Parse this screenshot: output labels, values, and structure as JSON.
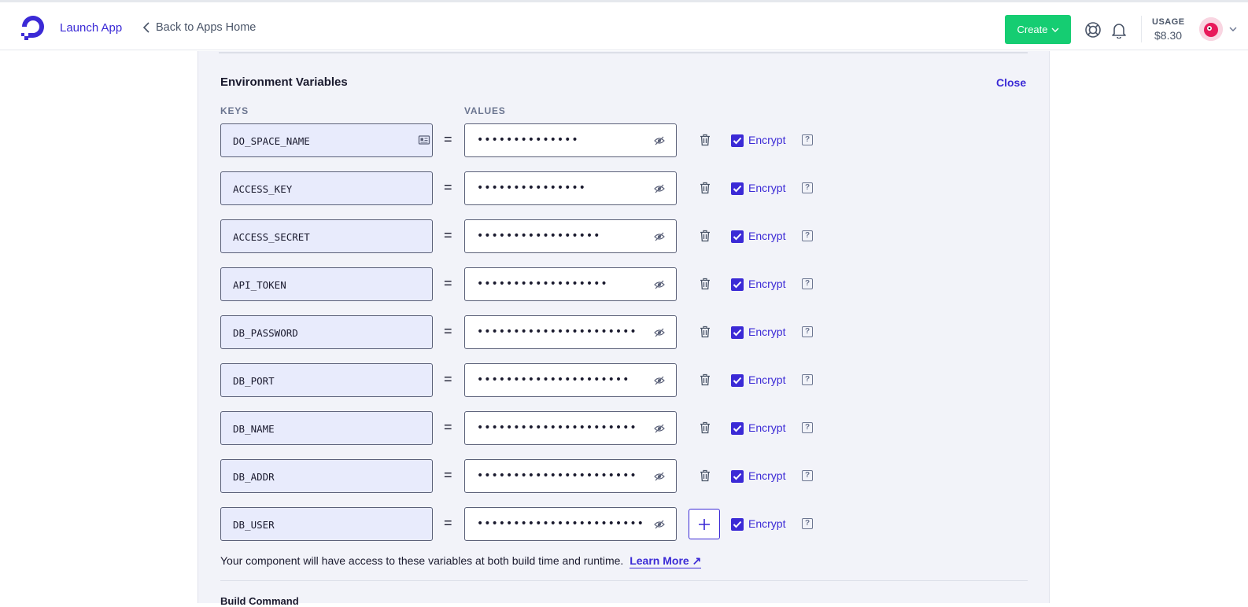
{
  "header": {
    "launch_label": "Launch App",
    "back_label": "Back to Apps Home",
    "create_label": "Create",
    "usage_label": "USAGE",
    "usage_value": "$8.30",
    "brand_color": "#0069ff",
    "create_color": "#15cd72"
  },
  "section": {
    "title": "Environment Variables",
    "close_label": "Close",
    "keys_header": "KEYS",
    "values_header": "VALUES"
  },
  "env_vars": [
    {
      "key": "DO_SPACE_NAME",
      "value": "••••••••••••••",
      "encrypt": true,
      "encrypt_label": "Encrypt",
      "action": "delete"
    },
    {
      "key": "ACCESS_KEY",
      "value": "•••••••••••••••",
      "encrypt": true,
      "encrypt_label": "Encrypt",
      "action": "delete"
    },
    {
      "key": "ACCESS_SECRET",
      "value": "•••••••••••••••••",
      "encrypt": true,
      "encrypt_label": "Encrypt",
      "action": "delete"
    },
    {
      "key": "API_TOKEN",
      "value": "••••••••••••••••••",
      "encrypt": true,
      "encrypt_label": "Encrypt",
      "action": "delete"
    },
    {
      "key": "DB_PASSWORD",
      "value": "••••••••••••••••••••••",
      "encrypt": true,
      "encrypt_label": "Encrypt",
      "action": "delete"
    },
    {
      "key": "DB_PORT",
      "value": "•••••••••••••••••••••",
      "encrypt": true,
      "encrypt_label": "Encrypt",
      "action": "delete"
    },
    {
      "key": "DB_NAME",
      "value": "••••••••••••••••••••••",
      "encrypt": true,
      "encrypt_label": "Encrypt",
      "action": "delete"
    },
    {
      "key": "DB_ADDR",
      "value": "••••••••••••••••••••••",
      "encrypt": true,
      "encrypt_label": "Encrypt",
      "action": "delete"
    },
    {
      "key": "DB_USER",
      "value": "•••••••••••••••••••••••",
      "encrypt": true,
      "encrypt_label": "Encrypt",
      "action": "add"
    }
  ],
  "footer": {
    "note": "Your component will have access to these variables at both build time and runtime.",
    "learn_more": "Learn More",
    "next_section": "Build Command"
  }
}
